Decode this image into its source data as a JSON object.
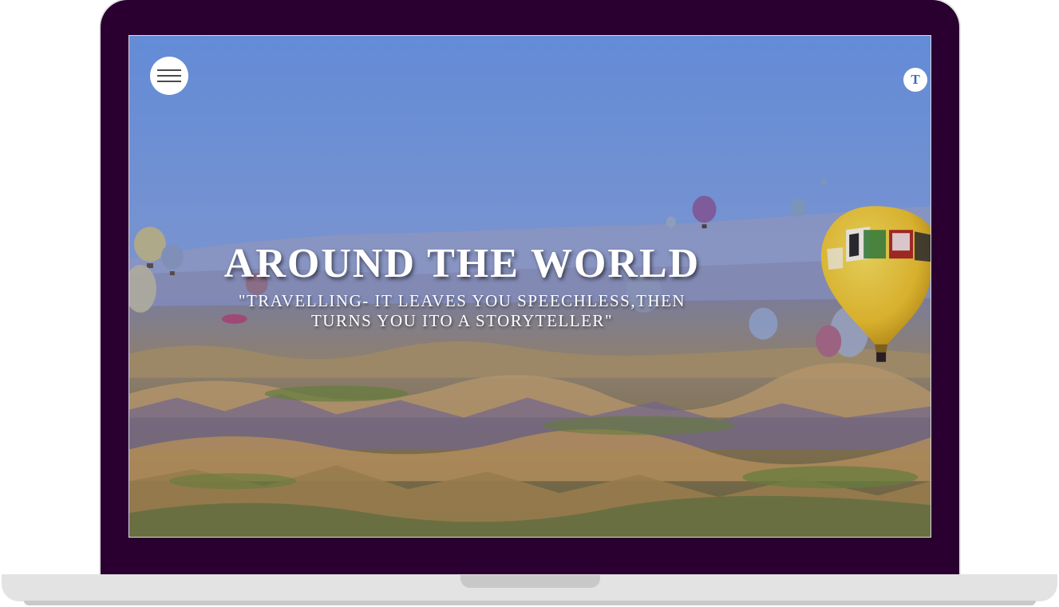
{
  "hero": {
    "title": "AROUND THE WORLD",
    "quote_line1": "\"TRAVELLING- IT LEAVES YOU SPEECHLESS,THEN",
    "quote_line2": "TURNS YOU ITO A STORYTELLER\""
  },
  "header": {
    "menu_icon": "hamburger-icon",
    "avatar_initial": "T"
  },
  "colors": {
    "frame": "#2a0030",
    "sky_top": "#6e9ceb",
    "avatar_text": "#3b67c9",
    "balloon_yellow": "#f2cc2b"
  }
}
